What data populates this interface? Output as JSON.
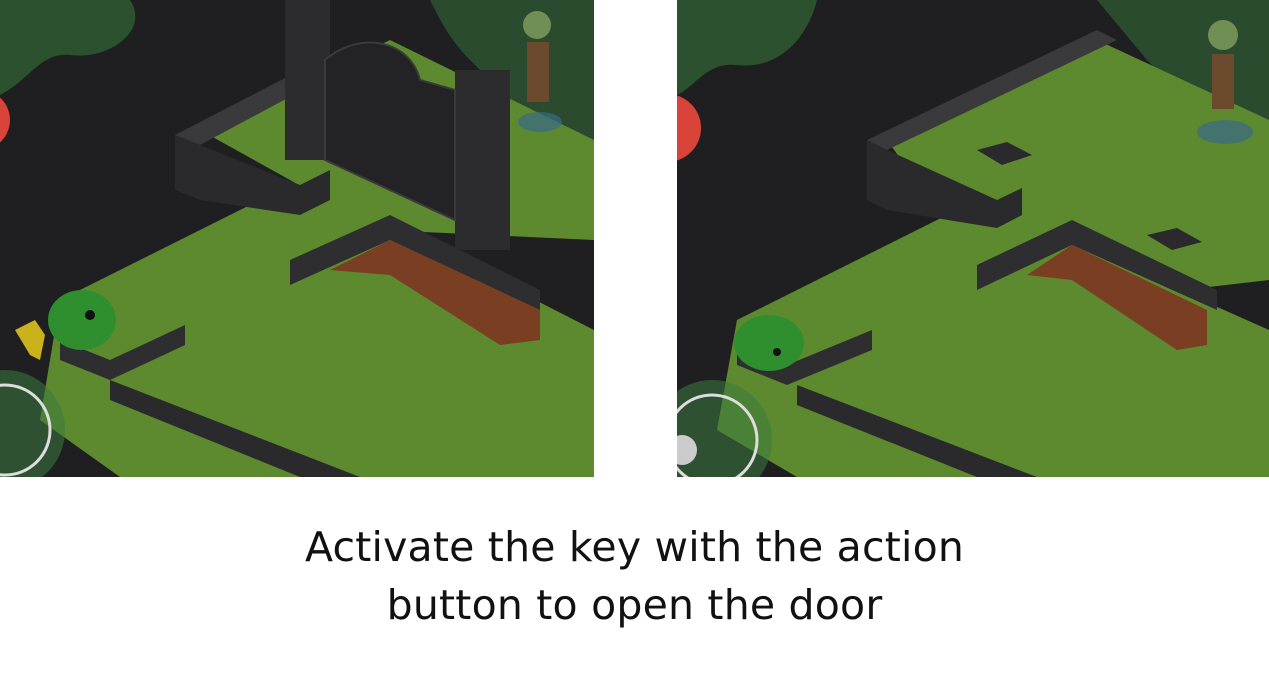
{
  "caption": {
    "line1": "Activate the key with the action",
    "line2": "button to open the door"
  },
  "panels": [
    {
      "id": "before",
      "door_state": "closed",
      "has_key": true
    },
    {
      "id": "after",
      "door_state": "open",
      "has_key": false
    }
  ],
  "colors": {
    "background": "#1f1f21",
    "floor": "#5d8a2e",
    "floor_dark": "#476e22",
    "wall": "#2a2a2c",
    "wall_top": "#3a3a3d",
    "dirt": "#8a4a2a",
    "slime": "#2f8f2f",
    "skeleton": "#6b4a2e",
    "key": "#c9b21a",
    "red_button": "#d9443a",
    "caption_text": "#111111"
  }
}
